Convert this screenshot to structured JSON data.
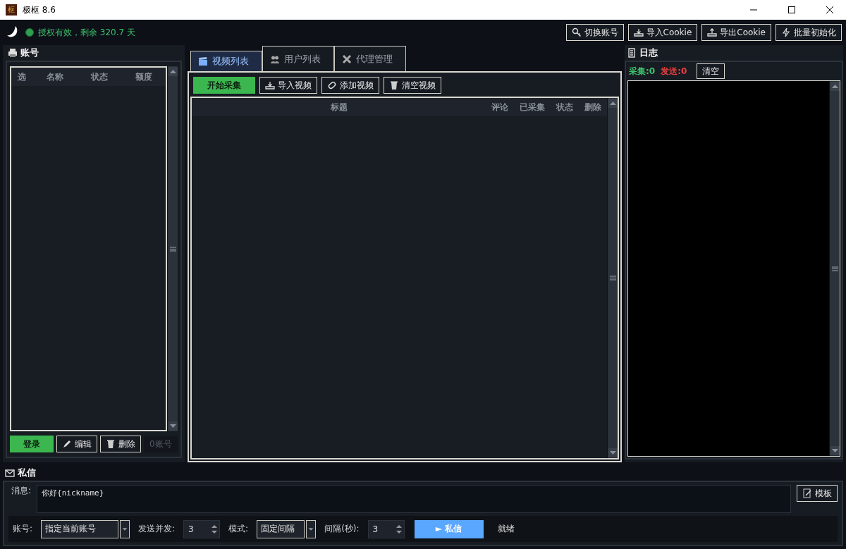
{
  "window": {
    "title": "极枢 8.6",
    "logo": "枢"
  },
  "license": {
    "text": "授权有效，剩余 320.7 天",
    "valid": true
  },
  "top_buttons": [
    "切换账号",
    "导入Cookie",
    "导出Cookie",
    "批量初始化"
  ],
  "accounts": {
    "title": "账号",
    "columns": [
      "选",
      "名称",
      "状态",
      "额度"
    ],
    "buttons": [
      {
        "label": "登录",
        "kind": "primary"
      },
      {
        "label": "编辑",
        "kind": "edit"
      },
      {
        "label": "删除",
        "kind": "delete"
      }
    ],
    "count": "0账号"
  },
  "tabs": [
    {
      "label": "视频列表",
      "selected": true
    },
    {
      "label": "用户列表",
      "selected": false
    },
    {
      "label": "代理管理",
      "selected": false
    }
  ],
  "video_toolbar": [
    {
      "label": "开始采集",
      "kind": "primary"
    },
    {
      "label": "导入视频",
      "kind": "import"
    },
    {
      "label": "添加视频",
      "kind": "link"
    },
    {
      "label": "清空视频",
      "kind": "delete"
    }
  ],
  "video_columns": [
    "标题",
    "评论",
    "已采集",
    "状态",
    "删除"
  ],
  "log": {
    "title": "日志",
    "collected": "采集:0",
    "sent": "发送:0",
    "clear": "清空"
  },
  "dm": {
    "title": "私信",
    "message_label": "消息:",
    "message": "你好{nickname}",
    "template": "模板",
    "account_label": "账号:",
    "account": "指定当前账号",
    "concurrency_label": "发送并发:",
    "concurrency": "3",
    "mode_label": "模式:",
    "mode": "固定间隔",
    "interval_label": "间隔(秒):",
    "interval": "3",
    "send": "► 私信",
    "status": "就绪"
  }
}
